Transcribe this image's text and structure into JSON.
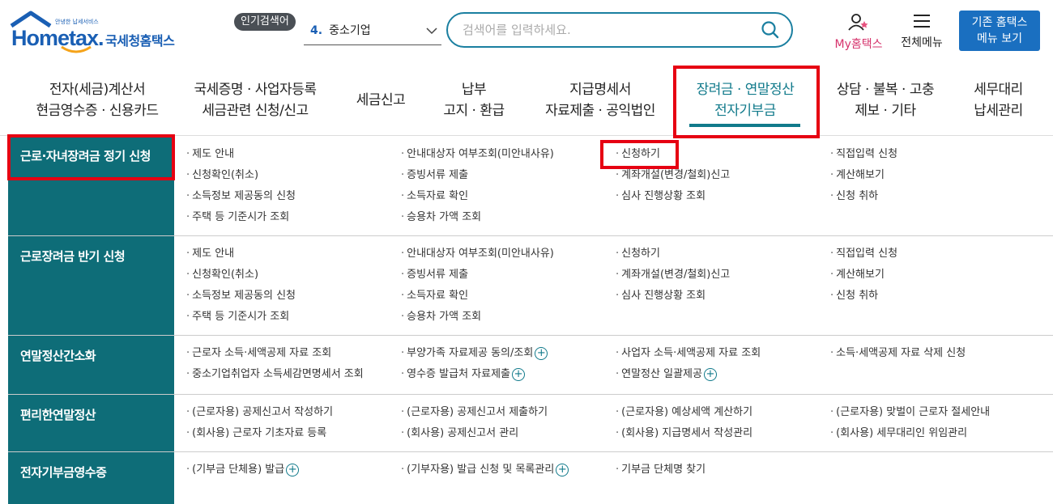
{
  "header": {
    "logo_small": "안녕한 납세서비스",
    "logo_main": "Hometax.",
    "logo_kr": "국세청홈택스",
    "popular_badge": "인기검색어",
    "popular_num": "4.",
    "popular_term": "중소기업",
    "search_placeholder": "검색어를 입력하세요.",
    "my_hometax": "My홈택스",
    "all_menu": "전체메뉴",
    "classic_line1": "기존 홈택스",
    "classic_line2": "메뉴 보기"
  },
  "gnb": [
    {
      "line1": "전자(세금)계산서",
      "line2": "현금영수증 · 신용카드"
    },
    {
      "line1": "국세증명 · 사업자등록",
      "line2": "세금관련 신청/신고"
    },
    {
      "line1": "세금신고",
      "line2": ""
    },
    {
      "line1": "납부",
      "line2": "고지 · 환급"
    },
    {
      "line1": "지급명세서",
      "line2": "자료제출 · 공익법인"
    },
    {
      "line1": "장려금 · 연말정산",
      "line2": "전자기부금"
    },
    {
      "line1": "상담 · 불복 · 고충",
      "line2": "제보 · 기타"
    },
    {
      "line1": "세무대리",
      "line2": "납세관리"
    }
  ],
  "sections": [
    {
      "title": "근로·자녀장려금 정기 신청",
      "items": [
        "제도 안내",
        "안내대상자 여부조회(미안내사유)",
        "신청하기",
        "직접입력 신청",
        "신청확인(취소)",
        "증빙서류 제출",
        "계좌개설(변경/철회)신고",
        "계산해보기",
        "소득정보 제공동의 신청",
        "소득자료 확인",
        "심사 진행상황 조회",
        "신청 취하",
        "주택 등 기준시가 조회",
        "승용차 가액 조회"
      ]
    },
    {
      "title": "근로장려금 반기 신청",
      "items": [
        "제도 안내",
        "안내대상자 여부조회(미안내사유)",
        "신청하기",
        "직접입력 신청",
        "신청확인(취소)",
        "증빙서류 제출",
        "계좌개설(변경/철회)신고",
        "계산해보기",
        "소득정보 제공동의 신청",
        "소득자료 확인",
        "심사 진행상황 조회",
        "신청 취하",
        "주택 등 기준시가 조회",
        "승용차 가액 조회"
      ]
    },
    {
      "title": "연말정산간소화",
      "items": [
        "근로자 소득·세액공제 자료 조회",
        "부양가족 자료제공 동의/조회",
        "사업자 소득·세액공제 자료 조회",
        "소득·세액공제 자료 삭제 신청",
        "중소기업취업자 소득세감면명세서 조회",
        "영수증 발급처 자료제출",
        "연말정산 일괄제공"
      ]
    },
    {
      "title": "편리한연말정산",
      "items": [
        "(근로자용) 공제신고서 작성하기",
        "(근로자용) 공제신고서 제출하기",
        "(근로자용) 예상세액 계산하기",
        "(근로자용) 맞벌이 근로자 절세안내",
        "(회사용) 근로자 기초자료 등록",
        "(회사용) 공제신고서 관리",
        "(회사용) 지급명세서 작성관리",
        "(회사용) 세무대리인 위임관리"
      ]
    },
    {
      "title": "전자기부금영수증",
      "items": [
        "(기부금 단체용) 발급",
        "(기부자용) 발급 신청 및 목록관리",
        "기부금 단체명 찾기"
      ]
    }
  ],
  "plus_symbol": "+",
  "colors": {
    "teal": "#0e6d78",
    "blue": "#1a6fc0",
    "highlight": "#e60012"
  }
}
